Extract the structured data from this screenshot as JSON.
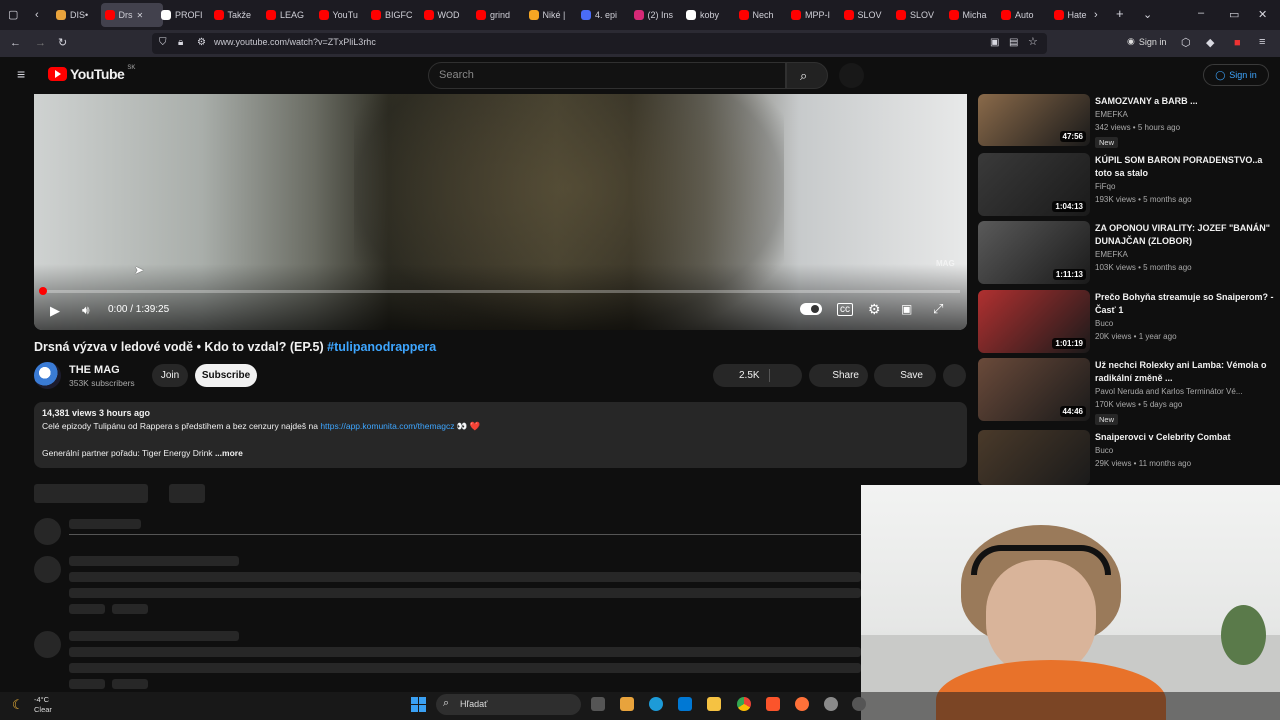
{
  "browser": {
    "tabs": [
      {
        "label": "DIS•",
        "color": "#e8a33c"
      },
      {
        "label": "Drs",
        "color": "#ff0000",
        "active": true
      },
      {
        "label": "PROFI",
        "color": "#ffffff"
      },
      {
        "label": "Takže",
        "color": "#ff0000"
      },
      {
        "label": "LEAG",
        "color": "#ff0000"
      },
      {
        "label": "YouTu",
        "color": "#ff0000"
      },
      {
        "label": "BIGFC",
        "color": "#ff0000"
      },
      {
        "label": "WOD",
        "color": "#ff0000"
      },
      {
        "label": "grind",
        "color": "#ff0000"
      },
      {
        "label": "Niké |",
        "color": "#f5a623"
      },
      {
        "label": "4. epi",
        "color": "#4a6cf7"
      },
      {
        "label": "(2) Ins",
        "color": "#d62976"
      },
      {
        "label": "koby",
        "color": "#ffffff"
      },
      {
        "label": "Nech",
        "color": "#ff0000"
      },
      {
        "label": "MPP-I",
        "color": "#ff0000"
      },
      {
        "label": "SLOV",
        "color": "#ff0000"
      },
      {
        "label": "SLOV",
        "color": "#ff0000"
      },
      {
        "label": "Micha",
        "color": "#ff0000"
      },
      {
        "label": "Auto",
        "color": "#ff0000"
      },
      {
        "label": "Hate",
        "color": "#ff0000"
      }
    ],
    "url": "www.youtube.com/watch?v=ZTxPliL3rhc",
    "signin_label": "Sign in"
  },
  "header": {
    "logo_text": "YouTube",
    "logo_region": "SK",
    "search_placeholder": "Search",
    "signin_label": "Sign in"
  },
  "player": {
    "time": "0:00 / 1:39:25",
    "watermark": "MAG",
    "progress": 0
  },
  "video": {
    "title": "Drsná výzva v ledové vodě • Kdo to vzdal? (EP.5)",
    "hashtag": "#tulipanodrappera",
    "channel": "THE MAG",
    "subscribers": "353K subscribers",
    "join_label": "Join",
    "subscribe_label": "Subscribe",
    "likes": "2.5K",
    "share_label": "Share",
    "save_label": "Save"
  },
  "description": {
    "meta": "14,381 views  3 hours ago",
    "line1": "Celé epizody Tulipánu od Rappera s předstihem a bez cenzury najdeš na",
    "link": "https://app.komunita.com/themagcz",
    "line1_emoji": "👀 ❤️",
    "line2": "Generální partner pořadu: Tiger Energy Drink",
    "more": "...more"
  },
  "recommendations": [
    {
      "title": "SAMOZVANY a BARB ...",
      "channel": "EMEFKA",
      "stats": "342 views • 5 hours ago",
      "duration": "47:56",
      "badge": "New",
      "thumb": "#8a6a4a"
    },
    {
      "title": "KÚPIL SOM BARON PORADENSTVO..a toto sa stalo",
      "channel": "FiFqo",
      "stats": "193K views • 5 months ago",
      "duration": "1:04:13",
      "badge": "",
      "thumb": "#3a3a3a"
    },
    {
      "title": "ZA OPONOU VIRALITY: JOZEF \"BANÁN\" DUNAJČAN (ZLOBOR)",
      "channel": "EMEFKA",
      "stats": "103K views • 5 months ago",
      "duration": "1:11:13",
      "badge": "",
      "thumb": "#5a5a5a"
    },
    {
      "title": "Prečo Bohyňa streamuje so Snaiperom? - Časť 1",
      "channel": "Buco",
      "stats": "20K views • 1 year ago",
      "duration": "1:01:19",
      "badge": "",
      "thumb": "#b03030"
    },
    {
      "title": "Už nechci Rolexky ani Lamba: Vémola o radikální změně ...",
      "channel": "Pavol Neruda and Karlos Terminátor Vé...",
      "stats": "170K views • 5 days ago",
      "duration": "44:46",
      "badge": "New",
      "thumb": "#6a4a3a"
    },
    {
      "title": "Snaiperovci v Celebrity Combat",
      "channel": "Buco",
      "stats": "29K views • 11 months ago",
      "duration": "",
      "badge": "",
      "thumb": "#4a3a2a"
    }
  ],
  "taskbar": {
    "temperature": "-4°C",
    "weather": "Clear",
    "search_label": "Hľadať"
  }
}
